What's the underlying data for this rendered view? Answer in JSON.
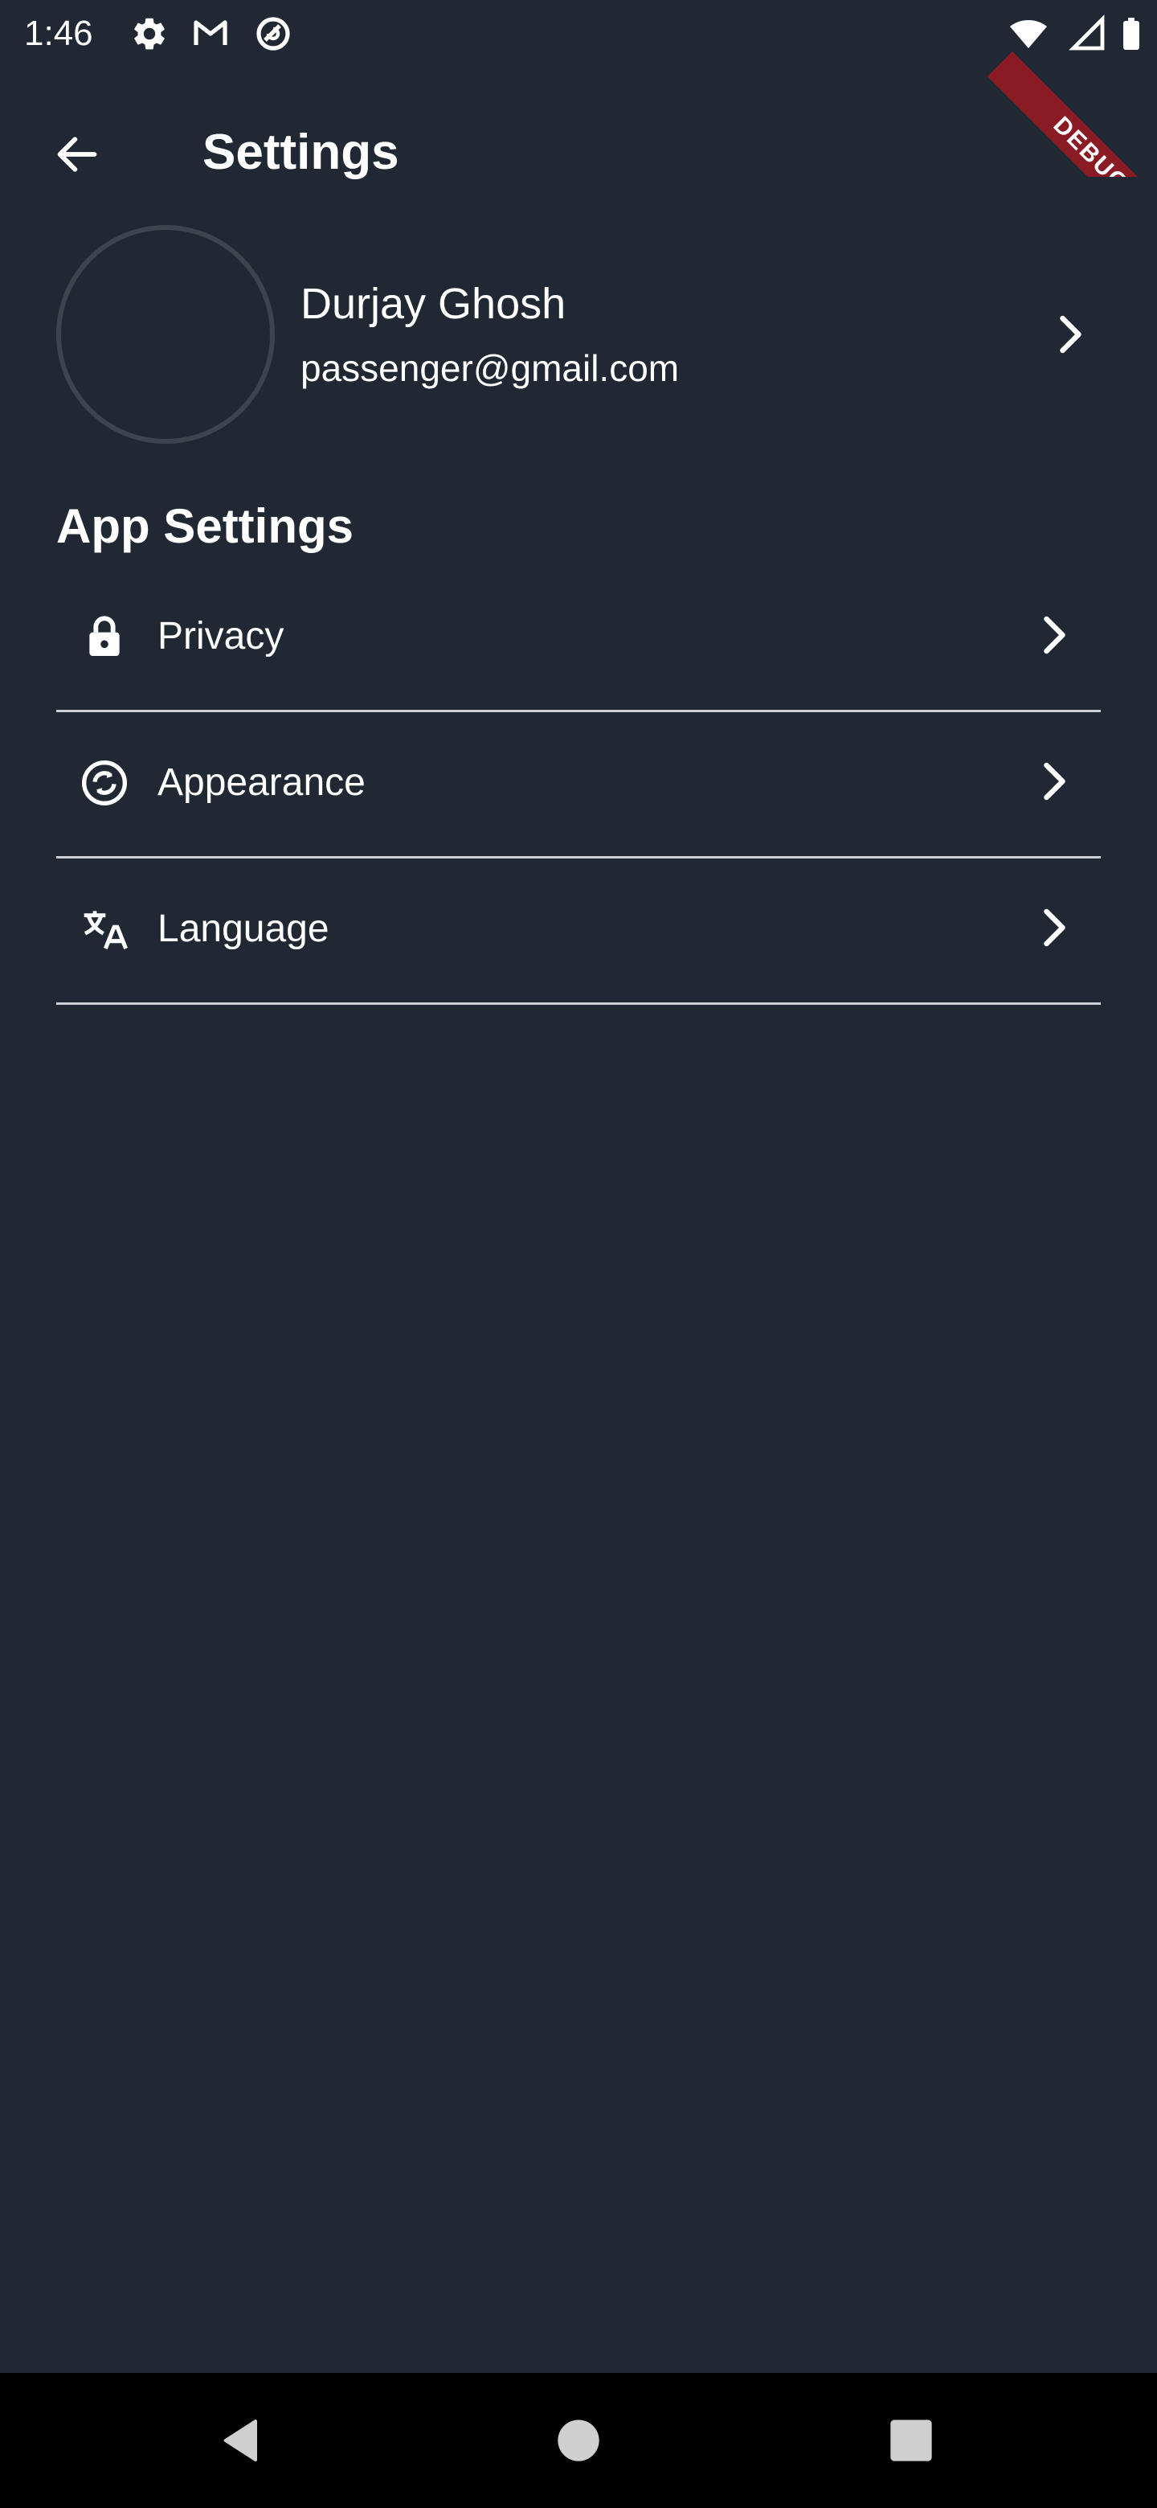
{
  "status_bar": {
    "time": "1:46",
    "left_icons": [
      "gear-icon",
      "gmail-icon",
      "do-not-disturb-icon"
    ],
    "right_icons": [
      "wifi-icon",
      "signal-icon",
      "battery-icon"
    ],
    "debug_banner": "DEBUG",
    "debug_color": "#8a1a24"
  },
  "app_bar": {
    "title": "Settings",
    "back_icon": "arrow-left-icon"
  },
  "profile": {
    "name": "Durjay Ghosh",
    "email": "passenger@gmail.com"
  },
  "app_settings": {
    "title": "App Settings",
    "items": [
      {
        "label": "Privacy",
        "icon": "lock-icon"
      },
      {
        "label": "Appearance",
        "icon": "appearance-sync-icon"
      },
      {
        "label": "Language",
        "icon": "translate-icon"
      }
    ]
  },
  "nav_bar": {
    "icons": [
      "nav-back-icon",
      "nav-home-icon",
      "nav-recents-icon"
    ]
  },
  "colors": {
    "background": "#202833",
    "text": "#ffffff",
    "divider": "#cdd1d6",
    "nav_bar": "#000000"
  }
}
